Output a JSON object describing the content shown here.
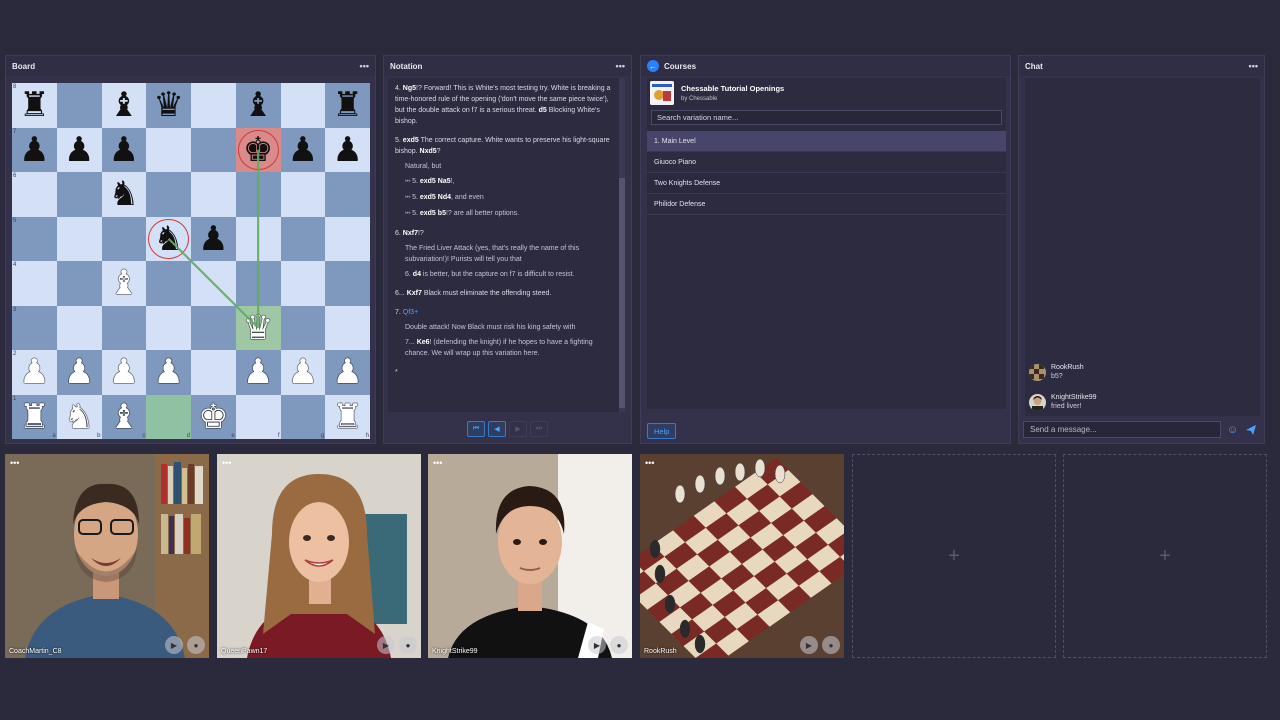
{
  "board_panel": {
    "title": "Board",
    "ranks": [
      "8",
      "7",
      "6",
      "5",
      "4",
      "3",
      "2",
      "1"
    ],
    "files": [
      "a",
      "b",
      "c",
      "d",
      "e",
      "f",
      "g",
      "h"
    ],
    "squares": [
      [
        "br",
        "",
        "bb",
        "bq",
        "",
        "bb",
        "",
        "br"
      ],
      [
        "bp",
        "bp",
        "bp",
        "",
        "",
        "bk",
        "bp",
        "bp"
      ],
      [
        "",
        "",
        "bn",
        "",
        "",
        "",
        "",
        ""
      ],
      [
        "",
        "",
        "",
        "bn",
        "bp",
        "",
        "",
        ""
      ],
      [
        "",
        "",
        "wb",
        "",
        "",
        "",
        "",
        ""
      ],
      [
        "",
        "",
        "",
        "",
        "",
        "wq",
        "",
        ""
      ],
      [
        "wp",
        "wp",
        "wp",
        "wp",
        "",
        "wp",
        "wp",
        "wp"
      ],
      [
        "wr",
        "wn",
        "wb",
        "",
        "wk",
        "",
        "",
        "wr"
      ]
    ],
    "highlights": {
      "f7": "red",
      "f3": "green",
      "d1": "teal"
    },
    "rings": [
      "f7",
      "d5"
    ],
    "arrows": [
      {
        "from": "f3",
        "to": "f7"
      },
      {
        "from": "f3",
        "to": "d5"
      }
    ]
  },
  "notation": {
    "title": "Notation",
    "blocks": [
      {
        "parts": [
          {
            "t": "4. "
          },
          {
            "t": "Ng5",
            "cls": "move"
          },
          {
            "t": "!? Forward! This is White's most testing try. White is breaking a time-honored rule of the opening ('don't move the same piece twice'), but the double attack on f7 is a serious threat. "
          },
          {
            "t": "d5",
            "cls": "move"
          },
          {
            "t": " Blocking White's bishop."
          }
        ]
      },
      {
        "parts": [
          {
            "t": "5. "
          },
          {
            "t": "exd5",
            "cls": "move"
          },
          {
            "t": " The correct capture. White wants to preserve his light-square bishop. "
          },
          {
            "t": "Nxd5",
            "cls": "move"
          },
          {
            "t": "?"
          }
        ],
        "subs": [
          [
            {
              "t": "Natural, but"
            }
          ],
          [
            {
              "t": "⏮ ",
              "cls": "arrowg"
            },
            {
              "t": "5. "
            },
            {
              "t": "exd5",
              "cls": "move"
            },
            {
              "t": " "
            },
            {
              "t": "Na5",
              "cls": "move"
            },
            {
              "t": "!,"
            }
          ],
          [
            {
              "t": "⏮ ",
              "cls": "arrowg"
            },
            {
              "t": "5. "
            },
            {
              "t": "exd5",
              "cls": "move"
            },
            {
              "t": " "
            },
            {
              "t": "Nd4",
              "cls": "move"
            },
            {
              "t": ", and even"
            }
          ],
          [
            {
              "t": "⏮ ",
              "cls": "arrowg"
            },
            {
              "t": "5. "
            },
            {
              "t": "exd5",
              "cls": "move"
            },
            {
              "t": " "
            },
            {
              "t": "b5",
              "cls": "move"
            },
            {
              "t": "!? are all better options."
            }
          ]
        ]
      },
      {
        "parts": [
          {
            "t": "6. "
          },
          {
            "t": "Nxf7",
            "cls": "move"
          },
          {
            "t": "!?"
          }
        ],
        "subs": [
          [
            {
              "t": "The Fried Liver Attack (yes, that's really the name of this subvariation!)! Purists will tell you that"
            }
          ],
          [
            {
              "t": "6. "
            },
            {
              "t": "d4",
              "cls": "move"
            },
            {
              "t": " is better, but the capture on f7 is difficult to resist."
            }
          ]
        ]
      },
      {
        "parts": [
          {
            "t": "6... "
          },
          {
            "t": "Kxf7",
            "cls": "move"
          },
          {
            "t": " Black must eliminate the offending steed."
          }
        ]
      },
      {
        "parts": [
          {
            "t": "7. "
          },
          {
            "t": "Qf3+",
            "cls": "blue"
          }
        ],
        "subs": [
          [
            {
              "t": "Double attack! Now Black must risk his king safety with"
            }
          ],
          [
            {
              "t": "7... "
            },
            {
              "t": "Ke6",
              "cls": "move"
            },
            {
              "t": "! (defending the knight) if he hopes to have a fighting chance. We will wrap up this variation here."
            }
          ]
        ]
      },
      {
        "parts": [
          {
            "t": "*"
          }
        ]
      }
    ],
    "nav": [
      "⏮",
      "◀",
      "▶",
      "⏭"
    ]
  },
  "courses": {
    "title": "Courses",
    "course_name": "Chessable Tutorial Openings",
    "course_by": "by Chessable",
    "search_placeholder": "Search variation name...",
    "variations": [
      "1. Main Level",
      "Giuoco Piano",
      "Two Knights Defense",
      "Philidor Defense"
    ],
    "help_label": "Help"
  },
  "chat": {
    "title": "Chat",
    "messages": [
      {
        "name": "RookRush",
        "text": "b5?"
      },
      {
        "name": "KnightStrike99",
        "text": "fried liver!"
      }
    ],
    "input_placeholder": "Send a message..."
  },
  "videos": [
    {
      "name": "CoachMartin_C8"
    },
    {
      "name": "QueenPawn17"
    },
    {
      "name": "KnightStrike99"
    },
    {
      "name": "RookRush"
    }
  ],
  "colors": {
    "accent": "#4aa3ff",
    "light_square": "#d3e0f6",
    "dark_square": "#7e98be"
  }
}
